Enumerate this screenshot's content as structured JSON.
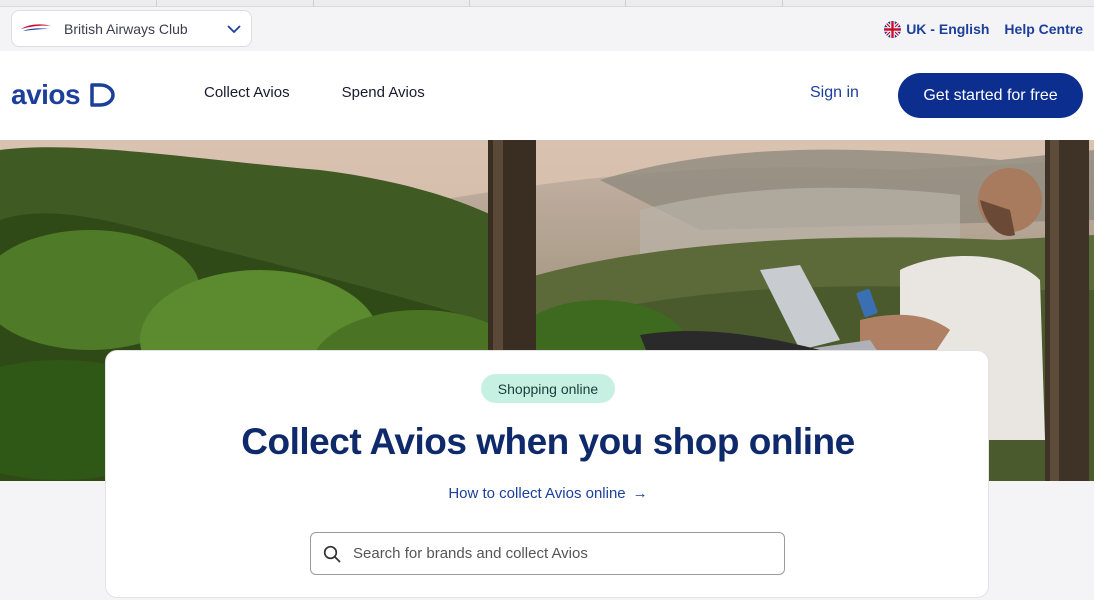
{
  "utility": {
    "club_label": "British Airways Club",
    "language": "UK - English",
    "help": "Help Centre"
  },
  "header": {
    "logo_text": "avios",
    "nav": [
      "Collect Avios",
      "Spend Avios"
    ],
    "sign_in": "Sign in",
    "cta": "Get started for free"
  },
  "hero": {
    "image": "man-with-laptop-and-phone-on-hillside-overlooking-sea"
  },
  "card": {
    "pill": "Shopping online",
    "headline": "Collect Avios when you shop online",
    "link": "How to collect Avios online",
    "link_arrow": "→",
    "search_placeholder": "Search for brands and collect Avios"
  },
  "colors": {
    "brand_blue": "#1c3f9c",
    "cta_bg": "#0c2e8f",
    "pill_bg": "#c6f1e2",
    "headline": "#0f2a6b"
  },
  "icons": [
    "ba-speedmarque-icon",
    "chevron-down-icon",
    "uk-flag-icon",
    "avios-logo-mark-icon",
    "search-icon",
    "arrow-right-icon"
  ]
}
